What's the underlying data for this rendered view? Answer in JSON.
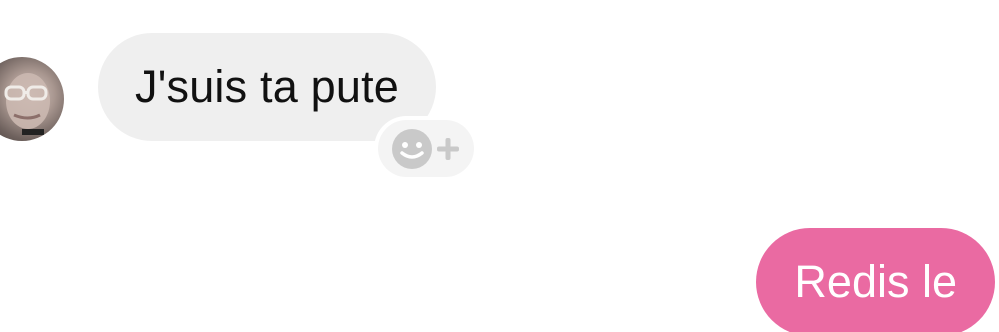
{
  "conversation": {
    "incoming_message": {
      "text": "J'suis ta pute",
      "bubble_color": "#efefef",
      "text_color": "#111111"
    },
    "reaction_button": {
      "icon": "smiley-plus-icon"
    },
    "outgoing_message": {
      "text": "Redis le",
      "bubble_color": "#ea6aa2",
      "text_color": "#ffffff"
    },
    "sender_avatar": {
      "icon": "avatar"
    }
  }
}
